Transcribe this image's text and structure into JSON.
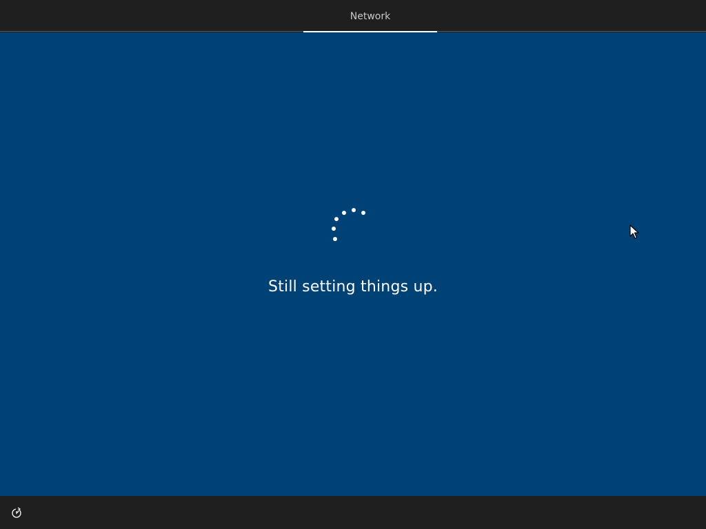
{
  "header": {
    "active_tab": "Network"
  },
  "main": {
    "status_text": "Still setting things up.",
    "spinner_icon": "loading-spinner-icon"
  },
  "footer": {
    "ease_of_access_icon": "ease-of-access-icon"
  },
  "colors": {
    "background": "#004275",
    "bars": "#1f1f1f",
    "text": "#ffffff"
  }
}
